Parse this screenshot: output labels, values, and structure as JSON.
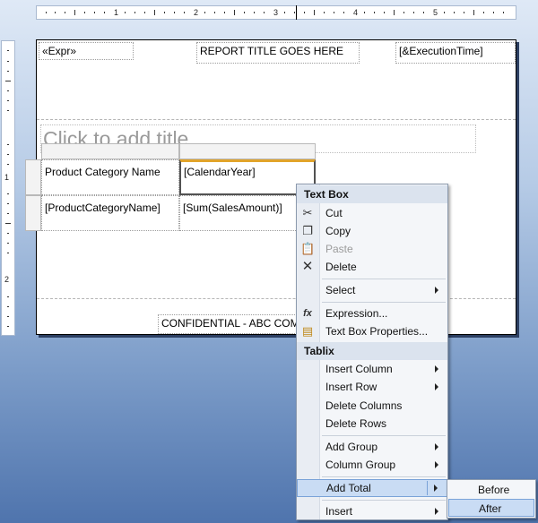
{
  "ruler": {
    "top_numbers": [
      "1",
      "2",
      "3",
      "4",
      "5"
    ],
    "left_numbers": [
      "1",
      "2"
    ]
  },
  "report": {
    "expr_label": "«Expr»",
    "report_title": "REPORT TITLE GOES HERE",
    "execution_time": "[&ExecutionTime]",
    "title_placeholder": "Click to add title",
    "footer_text": "CONFIDENTIAL - ABC COM"
  },
  "tablix": {
    "headers": [
      "Product Category Name",
      "[CalendarYear]"
    ],
    "row": [
      "[ProductCategoryName]",
      "[Sum(SalesAmount)]"
    ]
  },
  "context_menu": {
    "textbox_section": "Text Box",
    "cut": "Cut",
    "copy": "Copy",
    "paste": "Paste",
    "delete": "Delete",
    "select": "Select",
    "expression": "Expression...",
    "textbox_properties": "Text Box Properties...",
    "tablix_section": "Tablix",
    "insert_column": "Insert Column",
    "insert_row": "Insert Row",
    "delete_columns": "Delete Columns",
    "delete_rows": "Delete Rows",
    "add_group": "Add Group",
    "column_group": "Column Group",
    "add_total": "Add Total",
    "insert": "Insert"
  },
  "submenu": {
    "before": "Before",
    "after": "After"
  },
  "icons": {
    "cut": "scissors-icon",
    "copy": "copy-icon",
    "paste": "paste-icon",
    "delete": "delete-x-icon",
    "expression": "fx-icon",
    "textbox_properties": "properties-icon"
  }
}
